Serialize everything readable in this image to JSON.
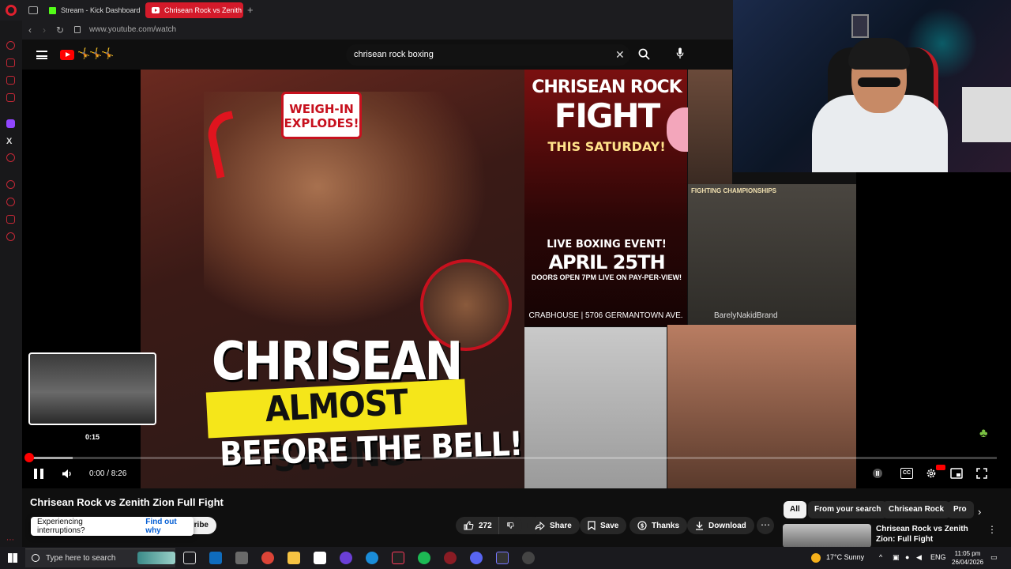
{
  "browser": {
    "tabs": [
      {
        "label": "Stream - Kick Dashboard",
        "active": false
      },
      {
        "label": "Chrisean Rock vs Zenith",
        "active": true
      }
    ],
    "url": "www.youtube.com/watch"
  },
  "youtube": {
    "search_query": "chrisean rock boxing"
  },
  "video": {
    "thumbnail_left": {
      "badge": "WEIGH-IN EXPLODES!",
      "headline_1": "CHRISEAN",
      "headline_2": "ALMOST SWUNG",
      "headline_3": "BEFORE THE BELL!"
    },
    "thumbnail_right": {
      "poster_line_1": "CHRISEAN ROCK",
      "poster_line_2": "FIGHT",
      "poster_line_3": "THIS SATURDAY!",
      "poster_line_4": "LIVE BOXING EVENT!",
      "poster_line_5": "APRIL 25TH",
      "poster_line_6": "DOORS OPEN 7PM LIVE ON PAY-PER-VIEW!",
      "poster_line_7": "CRABHOUSE | 5706 GERMANTOWN AVE.",
      "photo_header": "FIGHTING CHAMPIONSHIPS",
      "watermark": "BarelyNakidBrand"
    },
    "preview_time": "0:15",
    "time_display": "0:00 / 8:26",
    "progress": 0.0
  },
  "below": {
    "title": "Chrisean Rock vs Zenith Zion Full Fight",
    "subscribe_partial": "ribe",
    "toast_text": "Experiencing interruptions?",
    "toast_link": "Find out why",
    "likes": "272",
    "share": "Share",
    "save": "Save",
    "thanks": "Thanks",
    "download": "Download"
  },
  "chips": [
    "All",
    "From your search",
    "Chrisean Rock",
    "Pro"
  ],
  "recommendation": {
    "title": "Chrisean Rock vs Zenith Zion: Full Fight"
  },
  "taskbar": {
    "search_placeholder": "Type here to search",
    "weather": "17°C  Sunny",
    "language": "ENG",
    "time": "11:05 pm",
    "date": "26/04/2026"
  },
  "colors": {
    "youtube_red": "#ff0000",
    "tab_active": "#d41a2a",
    "kick_green": "#53fc18"
  }
}
